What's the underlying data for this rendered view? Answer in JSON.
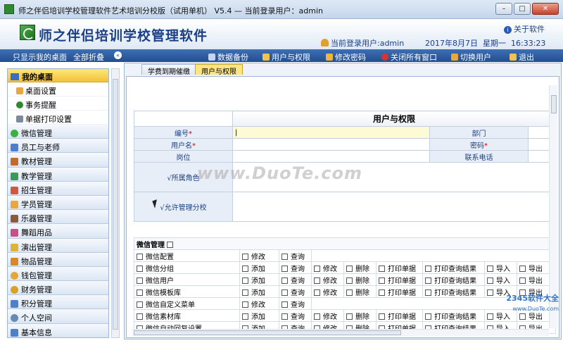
{
  "window": {
    "title": "师之伴侣培训学校管理软件艺术培训分校版（试用单机） V5.4 — 当前登录用户：admin",
    "min": "–",
    "max": "□",
    "close": "✕"
  },
  "header": {
    "app_title": "师之伴侣培训学校管理软件",
    "about": "关于软件",
    "current_user": "当前登录用户:admin",
    "date": "2017年8月7日",
    "weekday": "星期一",
    "time": "16:33:23"
  },
  "toolbar": {
    "desktop_only": "只显示我的桌面",
    "collapse_all": "全部折叠",
    "backup": "数据备份",
    "users_perms": "用户与权限",
    "change_pwd": "修改密码",
    "close_all": "关闭所有窗口",
    "switch_user": "切换用户",
    "exit": "退出"
  },
  "colors": {
    "toolbar": "#2d5a9e",
    "accent_yellow": "#fde682",
    "label_blue": "#1a3f86"
  },
  "sidebar": {
    "head": "我的桌面",
    "subs": [
      {
        "label": "桌面设置",
        "icon": "user-icon"
      },
      {
        "label": "事务提醒",
        "icon": "clock-icon"
      },
      {
        "label": "单据打印设置",
        "icon": "print-icon"
      }
    ],
    "items": [
      "微信管理",
      "员工与老师",
      "教材管理",
      "教学管理",
      "招生管理",
      "学员管理",
      "乐器管理",
      "舞蹈用品",
      "演出管理",
      "物品管理",
      "钱包管理",
      "财务管理",
      "积分管理",
      "个人空间",
      "基本信息"
    ]
  },
  "tabs": [
    "学费到期催缴",
    "用户与权限"
  ],
  "form": {
    "title": "用户与权限",
    "id_label": "编号",
    "name_label": "用户名",
    "post_label": "岗位",
    "role_label": "所属角色",
    "branch_label": "允许管理分校",
    "dept_label": "部门",
    "pwd_label": "密码",
    "phone_label": "联系电话",
    "req": "*"
  },
  "perm": {
    "group": "微信管理",
    "rows": [
      {
        "name": "微信配置",
        "actions": [
          "修改",
          "查询"
        ]
      },
      {
        "name": "微信分组",
        "actions": [
          "添加",
          "查询",
          "修改",
          "删除",
          "打印单据",
          "打印查询结果",
          "导入",
          "导出"
        ]
      },
      {
        "name": "微信用户",
        "actions": [
          "添加",
          "查询",
          "修改",
          "删除",
          "打印单据",
          "打印查询结果",
          "导入",
          "导出"
        ]
      },
      {
        "name": "微信模板库",
        "actions": [
          "添加",
          "查询",
          "修改",
          "删除",
          "打印单据",
          "打印查询结果",
          "导入",
          "导出"
        ]
      },
      {
        "name": "微信自定义菜单",
        "actions": [
          "修改",
          "查询"
        ]
      },
      {
        "name": "微信素材库",
        "actions": [
          "添加",
          "查询",
          "修改",
          "删除",
          "打印单据",
          "打印查询结果",
          "导入",
          "导出"
        ]
      },
      {
        "name": "微信自动回复设置",
        "actions": [
          "添加",
          "查询",
          "修改",
          "删除",
          "打印单据",
          "打印查询结果",
          "导入",
          "导出"
        ]
      }
    ]
  },
  "watermark": "www.DuoTe.com",
  "corner_mark": "2345软件大全",
  "corner_sub": "www.DuoTe.com"
}
